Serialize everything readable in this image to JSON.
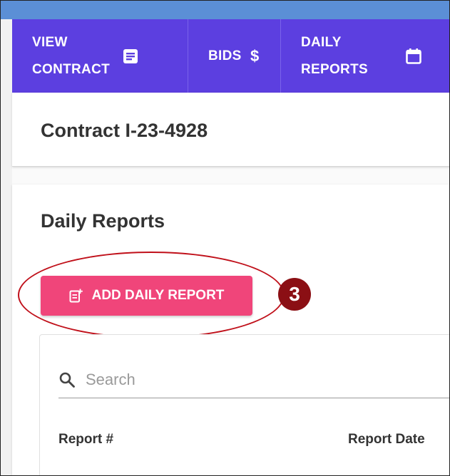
{
  "tabs": [
    {
      "label": "VIEW\nCONTRACT",
      "icon": "document-icon"
    },
    {
      "label": "BIDS",
      "icon": "dollar-icon"
    },
    {
      "label": "DAILY\nREPORTS",
      "icon": "calendar-icon"
    }
  ],
  "contract": {
    "title": "Contract I-23-4928"
  },
  "daily_reports": {
    "title": "Daily Reports",
    "add_button_label": "ADD DAILY REPORT",
    "step_number": "3",
    "search_placeholder": "Search",
    "columns": [
      "Report #",
      "Report Date"
    ]
  },
  "colors": {
    "tab_bar": "#5c3fe0",
    "add_button": "#f0457a",
    "highlight": "#c0101a",
    "step_badge": "#8b0f14"
  }
}
